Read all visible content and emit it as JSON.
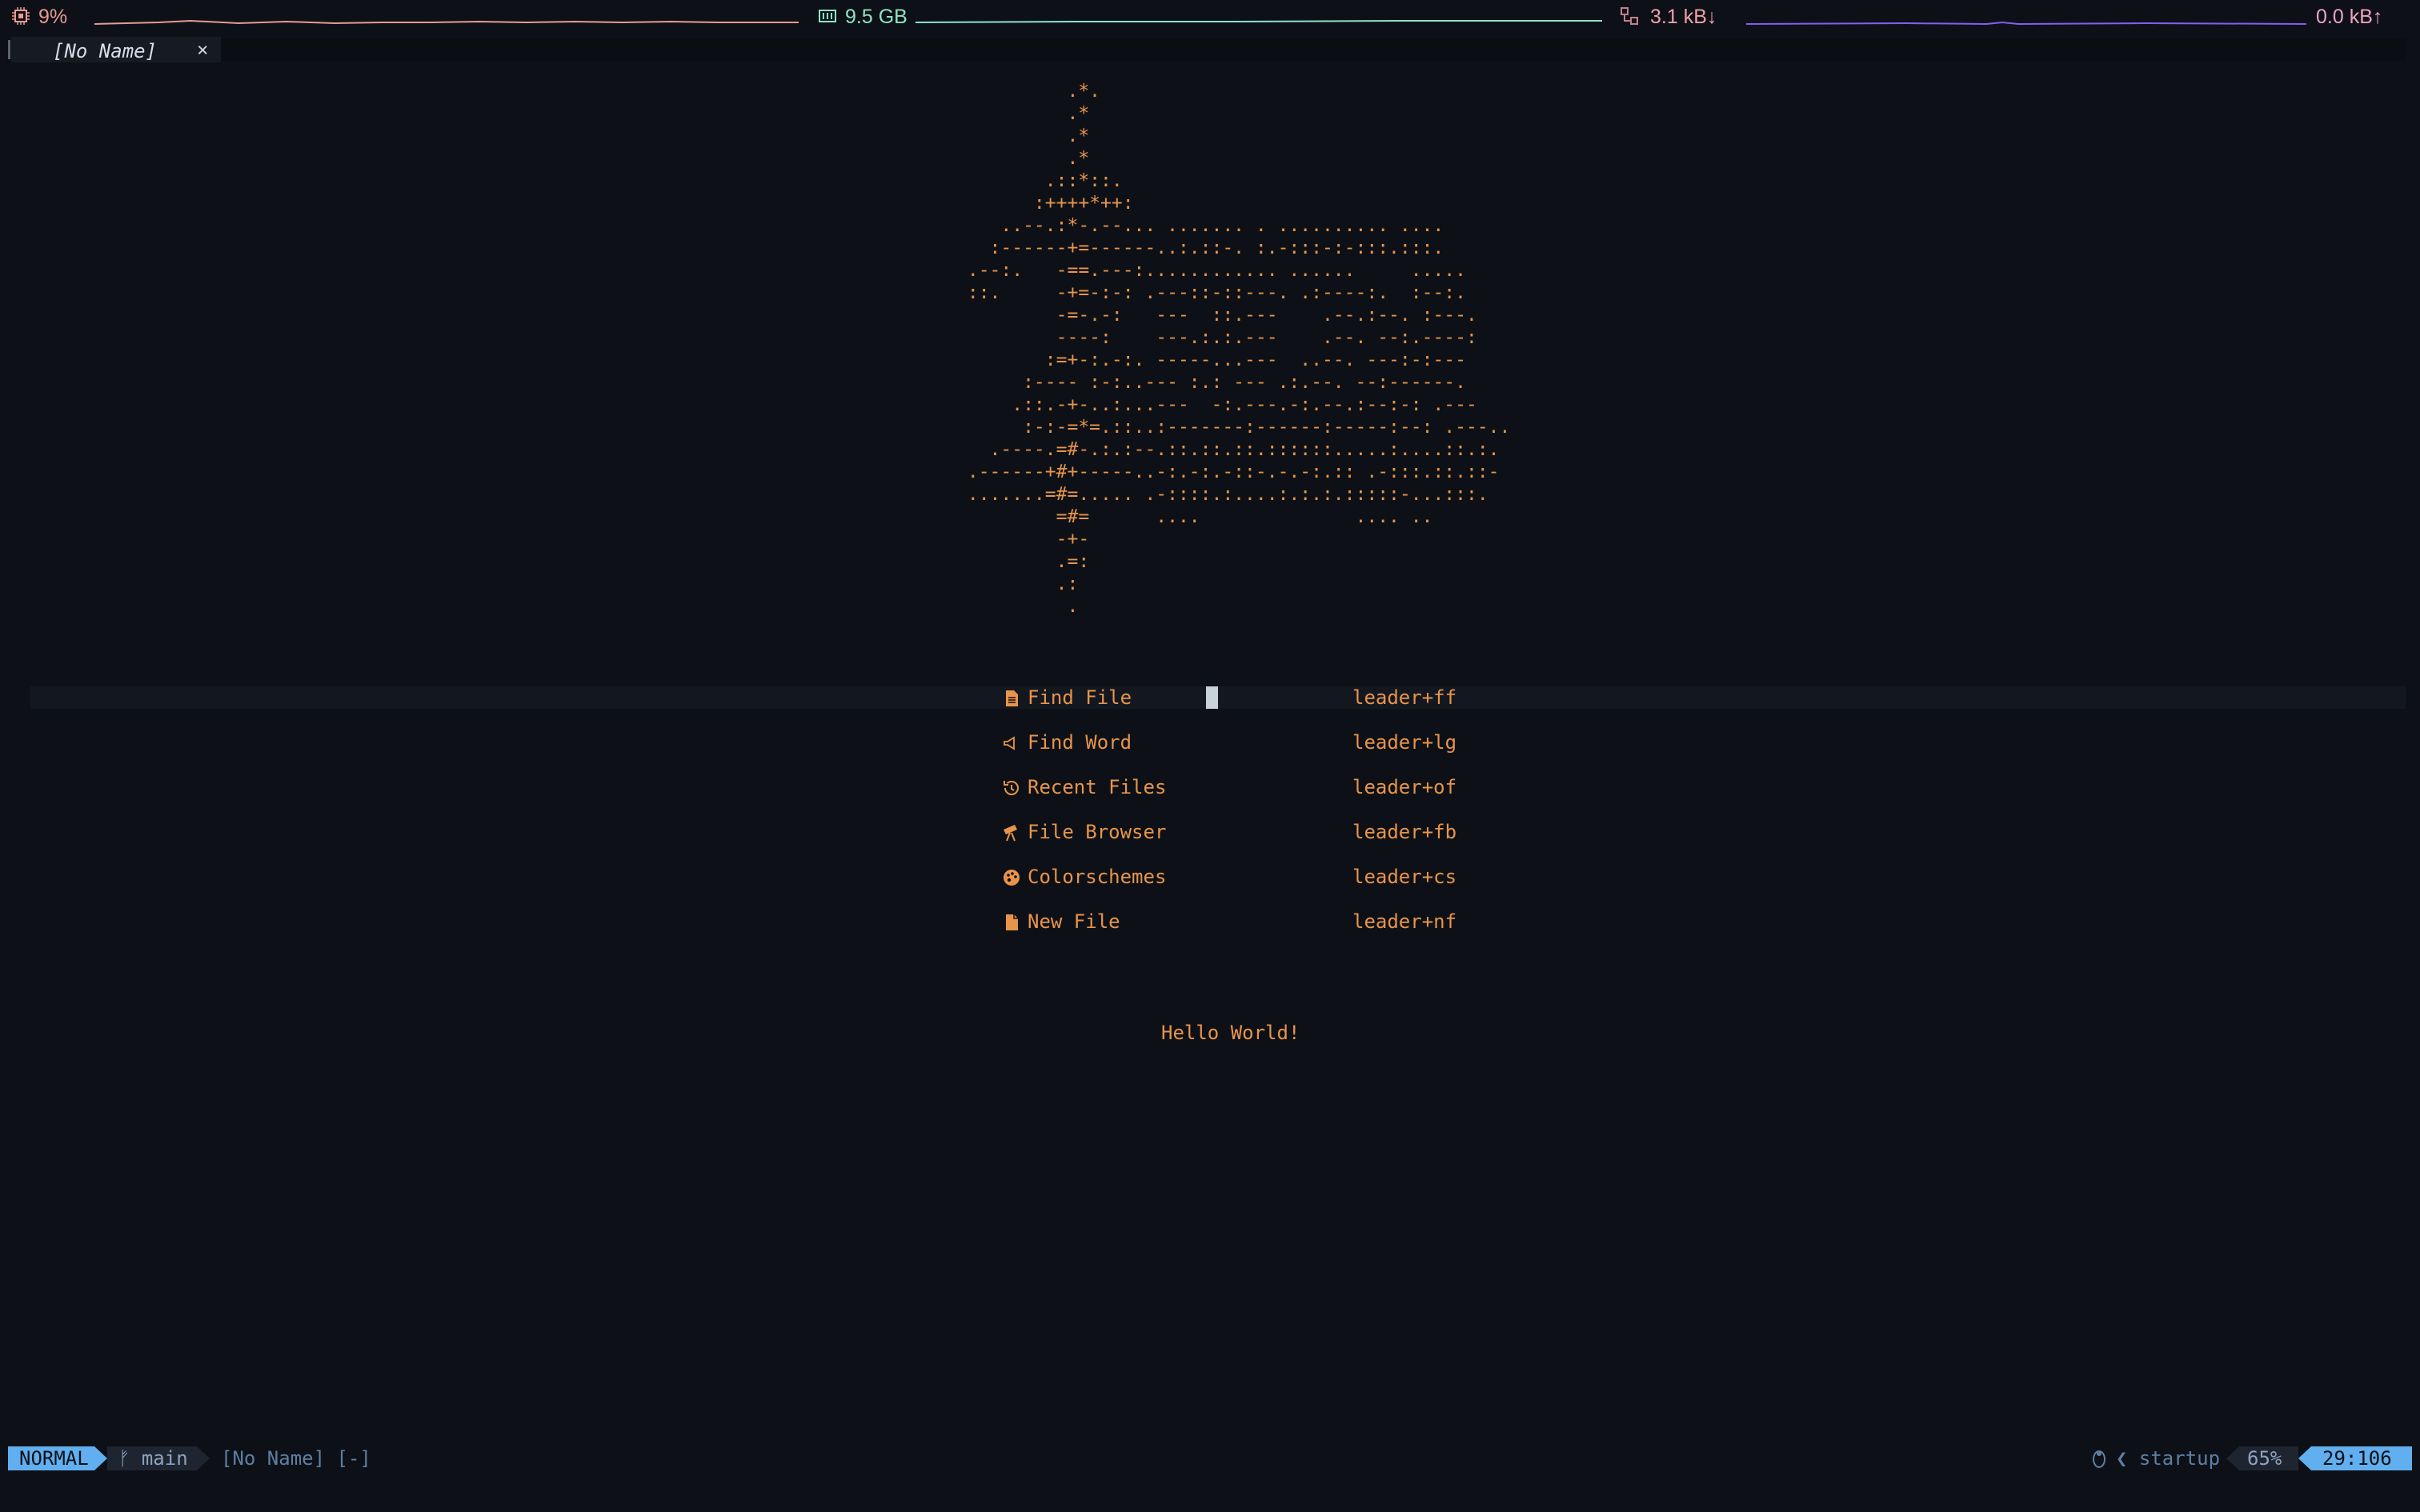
{
  "system_bar": {
    "cpu": {
      "icon": "cpu-icon",
      "value": "9%",
      "color": "#e89a91"
    },
    "memory": {
      "icon": "memory-icon",
      "value": "9.5 GB",
      "color": "#8fe3c5"
    },
    "network_down": {
      "icon": "network-icon",
      "value": "3.1 kB↓",
      "color": "#f0a0a8"
    },
    "network_up": {
      "value": "0.0 kB↑",
      "color": "#f0a0c8"
    }
  },
  "tabline": {
    "tabs": [
      {
        "label": "[No Name]",
        "close_icon": "close-icon"
      }
    ]
  },
  "ascii_art": [
    "          .*.",
    "          .*",
    "          .*",
    "          .*",
    "        .::*::.",
    "       :++++*++:",
    "    ..--.:*-.--... ....... . .......... ....",
    "   :------+=------..:.::-. :.-:::-:-:::.:::.",
    " .--:.   -==.---:............ ......     .....",
    " ::.     -+=-:-: .---::-::---. .:----:.  :--:.",
    "         -=-.-:   ---  ::.---    .--.:--. :---.",
    "         ----:    ---.:.:.---    .--. --:.----:",
    "        :=+-:.-:. -----...---  ..--. ---:-:---",
    "      :---- :-:..--- :.: --- .:.--. --:------.",
    "     .::.-+-..:...---  -:.---.-:.--.:--:-: .---",
    "      :-:-=*=.::..:-------:------:-----:--: .---..",
    "   .----.=#-.:.:--.::.::.::.::::::.....:....::.:.",
    " .------+#+-----..-:.-:.-::-.-.-:.:: .-:::.::.::-",
    " .......=#=..... .-::::.:....:.:.:.:::::-...:::.",
    "         =#=      ....              .... ..",
    "         -+-",
    "         .=:",
    "         .:",
    "          ."
  ],
  "dashboard": {
    "items": [
      {
        "label": "Find File",
        "key": "leader+ff",
        "icon": "file-icon"
      },
      {
        "label": "Find Word",
        "key": "leader+lg",
        "icon": "megaphone-icon"
      },
      {
        "label": "Recent Files",
        "key": "leader+of",
        "icon": "history-icon"
      },
      {
        "label": "File Browser",
        "key": "leader+fb",
        "icon": "telescope-icon"
      },
      {
        "label": "Colorschemes",
        "key": "leader+cs",
        "icon": "palette-icon"
      },
      {
        "label": "New File",
        "key": "leader+nf",
        "icon": "new-file-icon"
      }
    ],
    "footer": "Hello World!"
  },
  "statusline": {
    "mode": "NORMAL",
    "branch_icon": "git-branch-icon",
    "branch": "main",
    "filename": "[No Name] [-]",
    "lsp_icon": "penguin-icon",
    "startup": "startup",
    "percent": "65%",
    "position": "29:106"
  },
  "colors": {
    "background": "#0d1117",
    "accent_orange": "#e8944a",
    "statusline_blue": "#61afef"
  }
}
